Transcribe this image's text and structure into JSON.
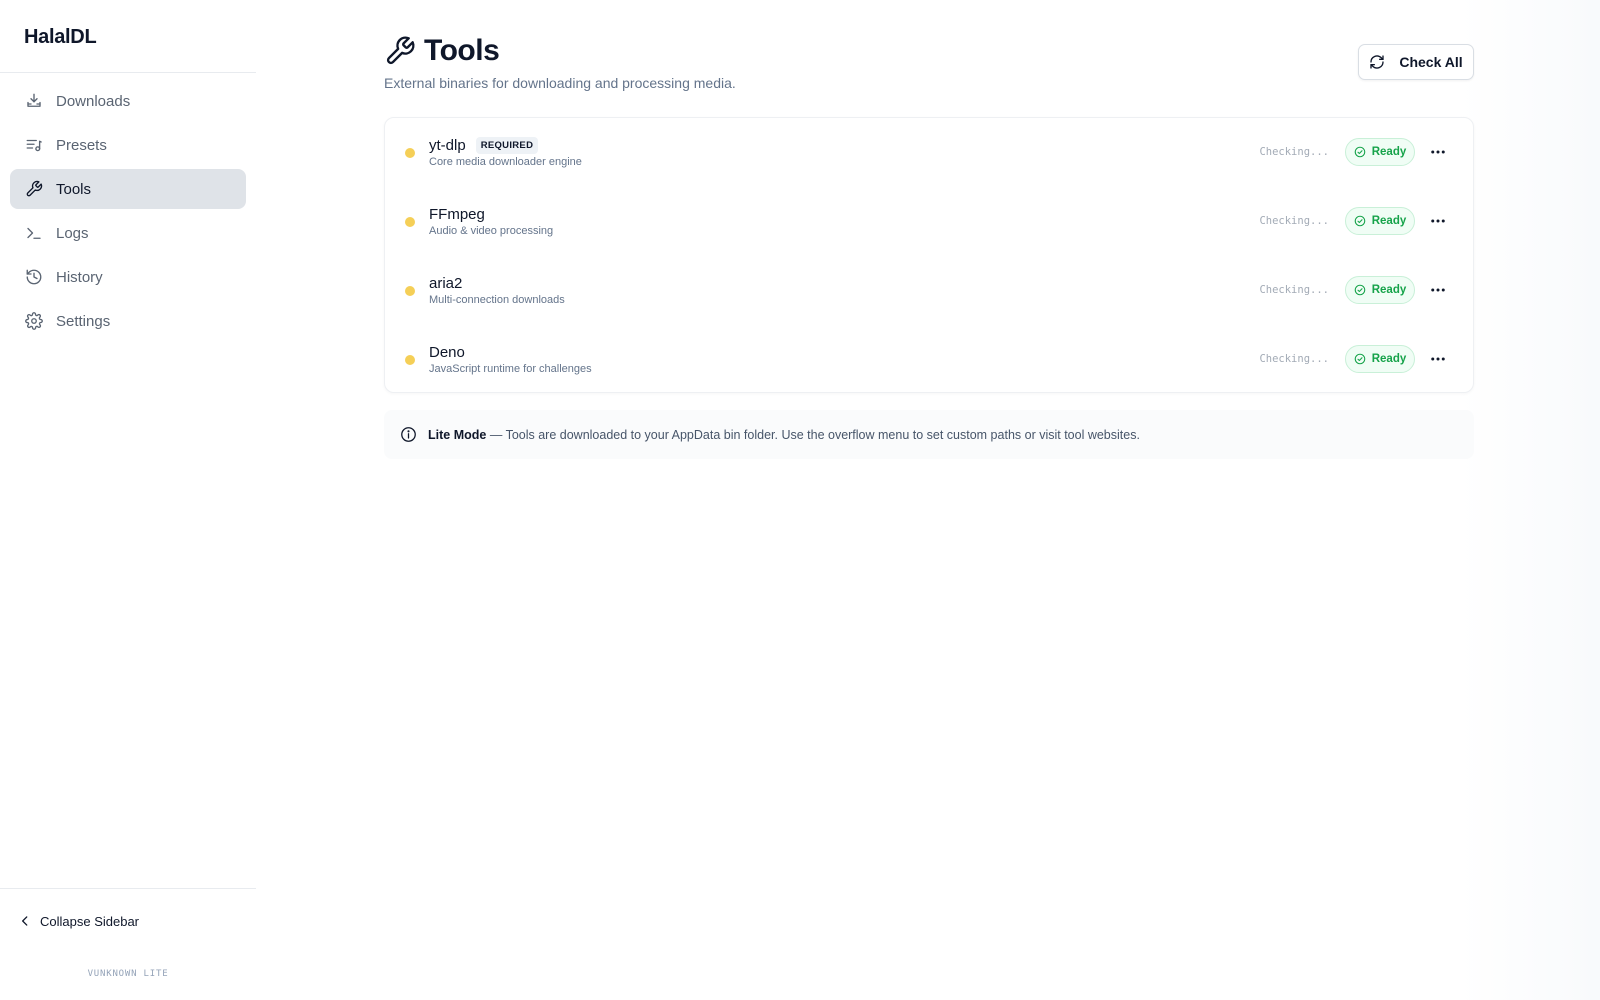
{
  "app": {
    "name": "HalalDL",
    "version": "VUNKNOWN LITE"
  },
  "sidebar": {
    "items": [
      {
        "label": "Downloads",
        "icon": "download-tray-icon"
      },
      {
        "label": "Presets",
        "icon": "list-music-icon"
      },
      {
        "label": "Tools",
        "icon": "wrench-icon",
        "active": true
      },
      {
        "label": "Logs",
        "icon": "terminal-icon"
      },
      {
        "label": "History",
        "icon": "history-icon"
      },
      {
        "label": "Settings",
        "icon": "gear-icon"
      }
    ],
    "collapse_label": "Collapse Sidebar"
  },
  "page": {
    "title": "Tools",
    "subtitle": "External binaries for downloading and processing media.",
    "check_all_label": "Check All"
  },
  "tools": [
    {
      "name": "yt-dlp",
      "badge": "REQUIRED",
      "description": "Core media downloader engine",
      "checking": "Checking...",
      "status": "Ready"
    },
    {
      "name": "FFmpeg",
      "badge": "",
      "description": "Audio & video processing",
      "checking": "Checking...",
      "status": "Ready"
    },
    {
      "name": "aria2",
      "badge": "",
      "description": "Multi-connection downloads",
      "checking": "Checking...",
      "status": "Ready"
    },
    {
      "name": "Deno",
      "badge": "",
      "description": "JavaScript runtime for challenges",
      "checking": "Checking...",
      "status": "Ready"
    }
  ],
  "info": {
    "title": "Lite Mode",
    "text": " — Tools are downloaded to your AppData bin folder. Use the overflow menu to set custom paths or visit tool websites."
  },
  "colors": {
    "status_dot": "#f5cf57",
    "ready_text": "#16a34a",
    "ready_bg": "#f0fdf5",
    "active_nav_bg": "#dfe3e8"
  }
}
